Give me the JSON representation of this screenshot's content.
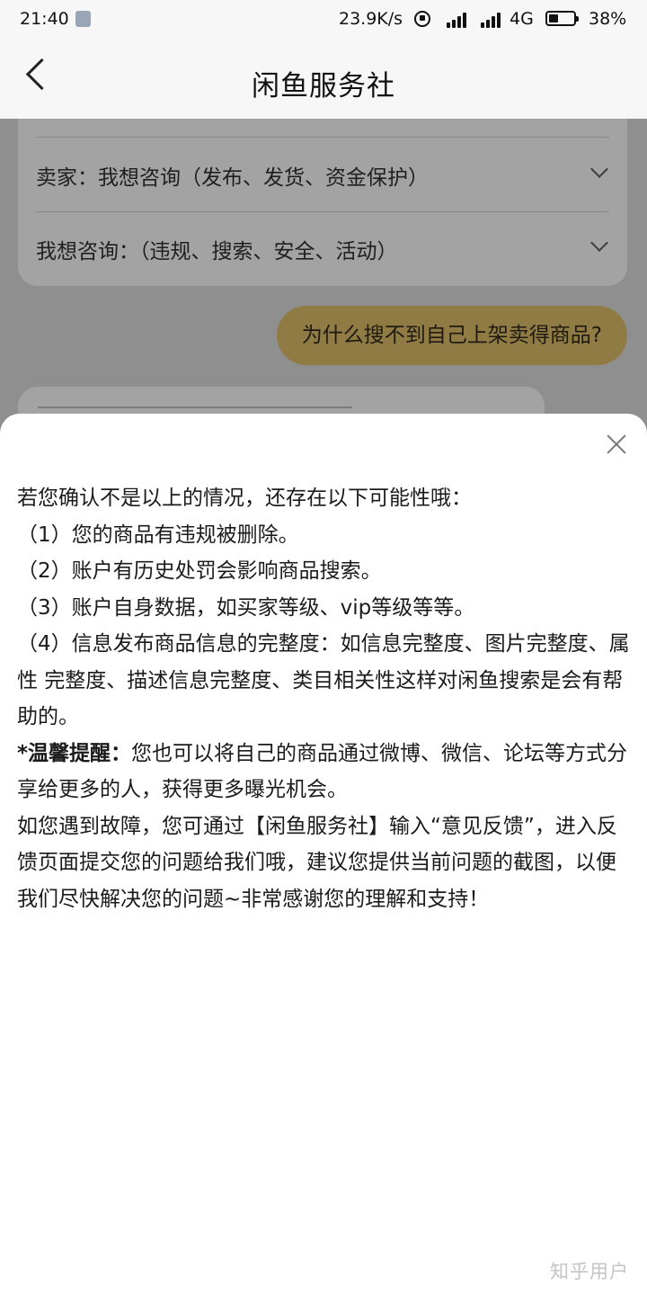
{
  "status_bar": {
    "time": "21:40",
    "net_speed": "23.9K/s",
    "network": "4G",
    "battery": "38%"
  },
  "nav": {
    "title": "闲鱼服务社"
  },
  "chat": {
    "faq_items": [
      "卖家：我想咨询（发布、发货、资金保护）",
      "我想咨询：（违规、搜索、安全、活动）"
    ],
    "user_message": "为什么搜不到自己上架卖得商品?"
  },
  "sheet": {
    "intro": "若您确认不是以上的情况，还存在以下可能性哦：",
    "items": [
      "（1）您的商品有违规被删除。",
      "（2）账户有历史处罚会影响商品搜索。",
      "（3）账户自身数据，如买家等级、vip等级等等。",
      "（4）信息发布商品信息的完整度：如信息完整度、图片完整度、属性 完整度、描述信息完整度、类目相关性这样对闲鱼搜索是会有帮助的。"
    ],
    "tip_label": "*温馨提醒：",
    "tip_text": "您也可以将自己的商品通过微博、微信、论坛等方式分享给更多的人，获得更多曝光机会。",
    "feedback": "如您遇到故障，您可通过【闲鱼服务社】输入“意见反馈”，进入反馈页面提交您的问题给我们哦，建议您提供当前问题的截图，以便我们尽快解决您的问题~非常感谢您的理解和支持！"
  },
  "watermark": "知乎用户"
}
